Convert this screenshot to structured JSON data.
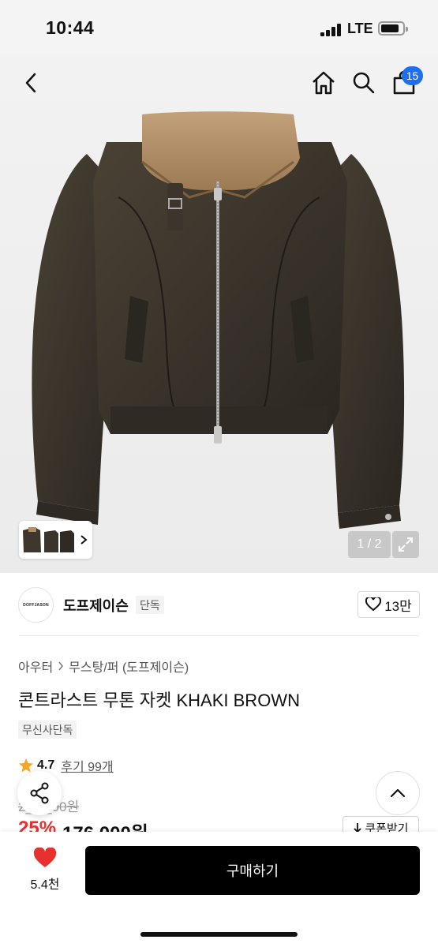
{
  "status_bar": {
    "time": "10:44",
    "network": "LTE",
    "icons": [
      "signal-icon",
      "battery-icon"
    ]
  },
  "nav": {
    "back_icon": "chevron-left-icon",
    "home_icon": "home-icon",
    "search_icon": "search-icon",
    "cart_icon": "shopping-bag-icon",
    "cart_count": "15",
    "badge_color": "#1f6ef0"
  },
  "gallery": {
    "page_counter": "1 / 2",
    "expand_icon": "expand-icon",
    "thumb_arrow_icon": "chevron-right-icon"
  },
  "brand": {
    "logo_text": "DOFFJASON",
    "name": "도프제이슨",
    "badge": "단독",
    "like_count": "13만",
    "like_icon": "heart-outline-icon"
  },
  "product": {
    "breadcrumb": [
      "아우터",
      "무스탕/퍼 (도프제이슨)"
    ],
    "title": "콘트라스트 무톤 자켓 KHAKI BROWN",
    "tag": "무신사단독",
    "rating": "4.7",
    "reviews": "후기 99개",
    "original_price": "2__,_00원",
    "discount": "25%",
    "price": "176,000원",
    "coupon_label": "쿠폰받기",
    "discount_color": "#e8312e"
  },
  "floating": {
    "share_icon": "share-icon",
    "top_icon": "chevron-up-icon"
  },
  "bottom_bar": {
    "wish_count": "5.4천",
    "wish_icon": "heart-filled-icon",
    "buy_label": "구매하기"
  }
}
